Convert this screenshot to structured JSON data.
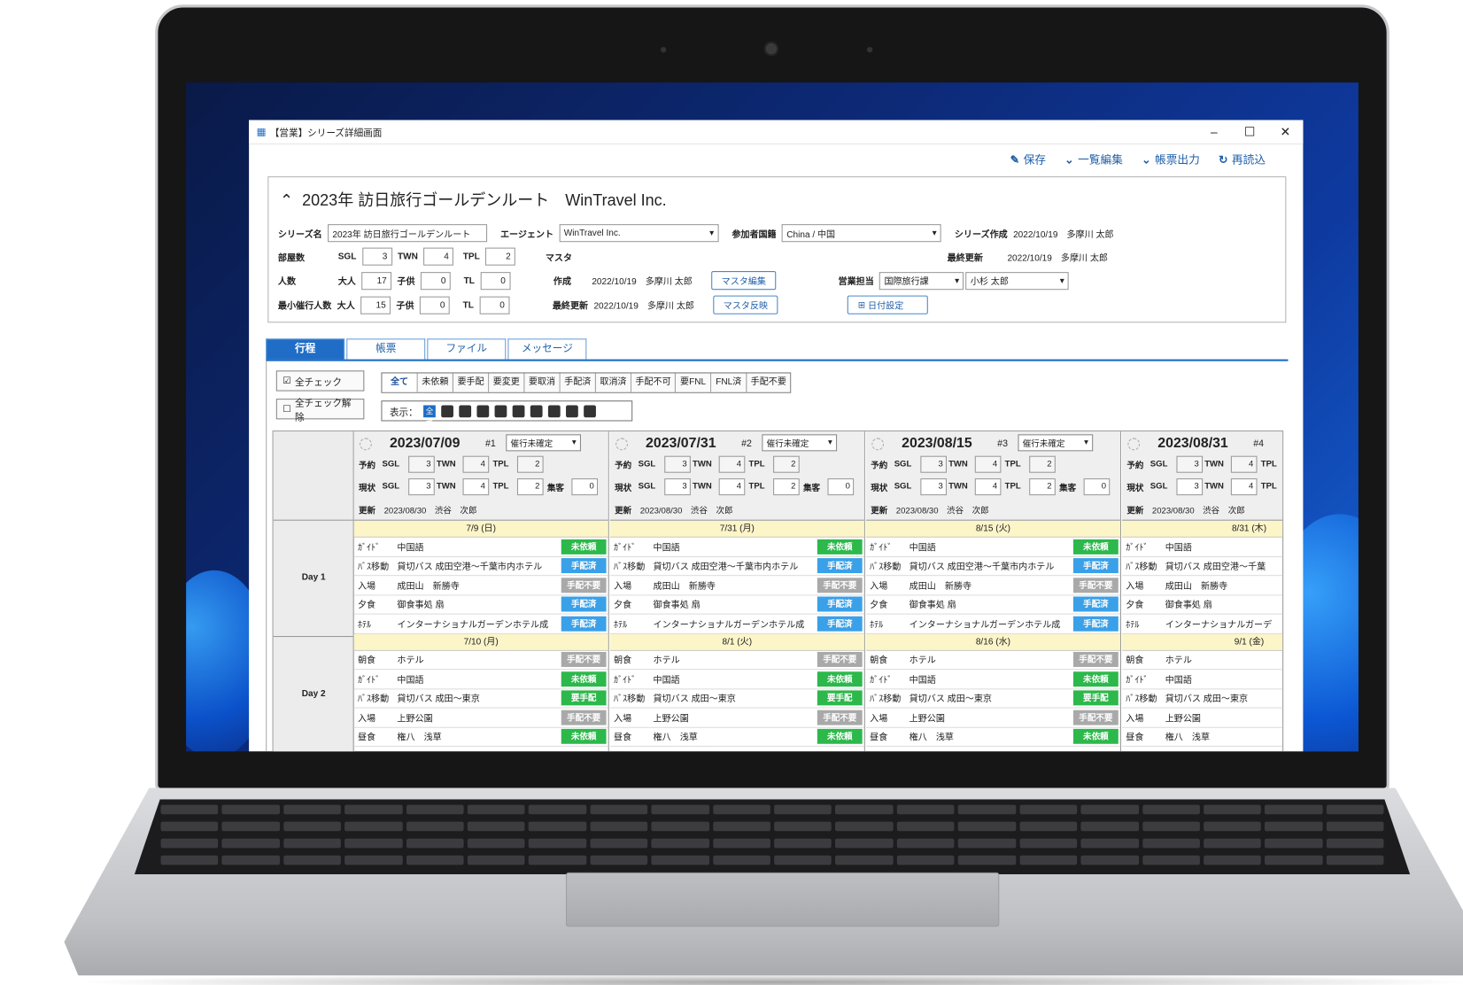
{
  "window": {
    "title": "【営業】シリーズ詳細画面",
    "controls": [
      "–",
      "☐",
      "✕"
    ]
  },
  "toolbar": {
    "save": "保存",
    "bulk_edit": "一覧編集",
    "report": "帳票出力",
    "reload": "再読込"
  },
  "header": {
    "title": "2023年 訪日旅行ゴールデンルート　WinTravel Inc."
  },
  "form": {
    "series_name_label": "シリーズ名",
    "series_name": "2023年 訪日旅行ゴールデンルート",
    "agent_label": "エージェント",
    "agent": "WinTravel Inc.",
    "nationality_label": "参加者国籍",
    "nationality": "China / 中国",
    "series_created_label": "シリーズ作成",
    "series_created": "2022/10/19　多摩川 太郎",
    "rooms_label": "部屋数",
    "sgl_label": "SGL",
    "sgl": "3",
    "twn_label": "TWN",
    "twn": "4",
    "tpl_label": "TPL",
    "tpl": "2",
    "master_label": "マスタ",
    "last_update_label": "最終更新",
    "last_update": "2022/10/19　多摩川 太郎",
    "people_label": "人数",
    "adult_label": "大人",
    "adult": "17",
    "child_label": "子供",
    "child": "0",
    "tl_label": "TL",
    "tl": "0",
    "created_label": "作成",
    "created": "2022/10/19　多摩川 太郎",
    "master_edit": "マスタ編集",
    "sales_label": "営業担当",
    "sales_dept": "国際旅行課",
    "sales_person": "小杉 太郎",
    "min_people_label": "最小催行人数",
    "min_adult": "15",
    "min_child": "0",
    "min_tl": "0",
    "last_update2_label": "最終更新",
    "last_update2": "2022/10/19　多摩川 太郎",
    "master_apply": "マスタ反映",
    "date_setting": "日付設定"
  },
  "tabs": [
    "行程",
    "帳票",
    "ファイル",
    "メッセージ"
  ],
  "filters": {
    "check_all": "全チェック",
    "uncheck_all": "全チェック解除",
    "status": [
      "全て",
      "未依頼",
      "要手配",
      "要変更",
      "要取消",
      "手配済",
      "取消済",
      "手配不可",
      "要FNL",
      "FNL済",
      "手配不要"
    ],
    "display_label": "表示：",
    "display_all": "全て"
  },
  "labels": {
    "yoyaku": "予約",
    "genjo": "現状",
    "shukyaku": "集客",
    "koushin": "更新",
    "sgl": "SGL",
    "twn": "TWN",
    "tpl": "TPL",
    "tw": "TI"
  },
  "days": [
    "Day 1",
    "Day 2"
  ],
  "columns": [
    {
      "date": "2023/07/09",
      "no": "#1",
      "status": "催行未確定",
      "r": [
        "3",
        "4",
        "2"
      ],
      "c": [
        "3",
        "4",
        "2",
        "0"
      ],
      "upd": "2023/08/30　渋谷　次郎",
      "d1": "7/9 (日)",
      "d2": "7/10 (月)",
      "day1": [
        [
          "ｶﾞｲﾄﾞ",
          "中国語",
          "未依頼",
          "g"
        ],
        [
          "ﾊﾞｽ移動",
          "貸切バス 成田空港～千葉市内ホテル",
          "手配済",
          "b"
        ],
        [
          "入場",
          "成田山　新勝寺",
          "手配不要",
          "x"
        ],
        [
          "夕食",
          "御食事処 扇",
          "手配済",
          "b"
        ],
        [
          "ﾎﾃﾙ",
          "インターナショナルガーデンホテル成",
          "手配済",
          "b"
        ]
      ],
      "day2": [
        [
          "朝食",
          "ホテル",
          "手配不要",
          "x"
        ],
        [
          "ｶﾞｲﾄﾞ",
          "中国語",
          "未依頼",
          "g"
        ],
        [
          "ﾊﾞｽ移動",
          "貸切バス 成田～東京",
          "要手配",
          "g"
        ],
        [
          "入場",
          "上野公園",
          "手配不要",
          "x"
        ],
        [
          "昼食",
          "権八　浅草",
          "未依頼",
          "g"
        ]
      ]
    },
    {
      "date": "2023/07/31",
      "no": "#2",
      "status": "催行未確定",
      "r": [
        "3",
        "4",
        "2"
      ],
      "c": [
        "3",
        "4",
        "2",
        "0"
      ],
      "upd": "2023/08/30　渋谷　次郎",
      "d1": "7/31 (月)",
      "d2": "8/1 (火)",
      "day1": [
        [
          "ｶﾞｲﾄﾞ",
          "中国語",
          "未依頼",
          "g"
        ],
        [
          "ﾊﾞｽ移動",
          "貸切バス 成田空港～千葉市内ホテル",
          "手配済",
          "b"
        ],
        [
          "入場",
          "成田山　新勝寺",
          "手配不要",
          "x"
        ],
        [
          "夕食",
          "御食事処 扇",
          "手配済",
          "b"
        ],
        [
          "ﾎﾃﾙ",
          "インターナショナルガーデンホテル成",
          "手配済",
          "b"
        ]
      ],
      "day2": [
        [
          "朝食",
          "ホテル",
          "手配不要",
          "x"
        ],
        [
          "ｶﾞｲﾄﾞ",
          "中国語",
          "未依頼",
          "g"
        ],
        [
          "ﾊﾞｽ移動",
          "貸切バス 成田～東京",
          "要手配",
          "g"
        ],
        [
          "入場",
          "上野公園",
          "手配不要",
          "x"
        ],
        [
          "昼食",
          "権八　浅草",
          "未依頼",
          "g"
        ]
      ]
    },
    {
      "date": "2023/08/15",
      "no": "#3",
      "status": "催行未確定",
      "r": [
        "3",
        "4",
        "2"
      ],
      "c": [
        "3",
        "4",
        "2",
        "0"
      ],
      "upd": "2023/08/30　渋谷　次郎",
      "d1": "8/15 (火)",
      "d2": "8/16 (水)",
      "day1": [
        [
          "ｶﾞｲﾄﾞ",
          "中国語",
          "未依頼",
          "g"
        ],
        [
          "ﾊﾞｽ移動",
          "貸切バス 成田空港～千葉市内ホテル",
          "手配済",
          "b"
        ],
        [
          "入場",
          "成田山　新勝寺",
          "手配不要",
          "x"
        ],
        [
          "夕食",
          "御食事処 扇",
          "手配済",
          "b"
        ],
        [
          "ﾎﾃﾙ",
          "インターナショナルガーデンホテル成",
          "手配済",
          "b"
        ]
      ],
      "day2": [
        [
          "朝食",
          "ホテル",
          "手配不要",
          "x"
        ],
        [
          "ｶﾞｲﾄﾞ",
          "中国語",
          "未依頼",
          "g"
        ],
        [
          "ﾊﾞｽ移動",
          "貸切バス 成田～東京",
          "要手配",
          "g"
        ],
        [
          "入場",
          "上野公園",
          "手配不要",
          "x"
        ],
        [
          "昼食",
          "権八　浅草",
          "未依頼",
          "g"
        ]
      ]
    },
    {
      "date": "2023/08/31",
      "no": "#4",
      "status": "",
      "r": [
        "3",
        "4",
        ""
      ],
      "c": [
        "3",
        "4",
        "",
        ""
      ],
      "upd": "2023/08/30　渋谷　次郎",
      "d1": "8/31 (木)",
      "d2": "9/1 (金)",
      "day1": [
        [
          "ｶﾞｲﾄﾞ",
          "中国語",
          "",
          ""
        ],
        [
          "ﾊﾞｽ移動",
          "貸切バス 成田空港～千葉",
          "",
          ""
        ],
        [
          "入場",
          "成田山　新勝寺",
          "",
          ""
        ],
        [
          "夕食",
          "御食事処 扇",
          "",
          ""
        ],
        [
          "ﾎﾃﾙ",
          "インターナショナルガーデ",
          "",
          ""
        ]
      ],
      "day2": [
        [
          "朝食",
          "ホテル",
          "",
          ""
        ],
        [
          "ｶﾞｲﾄﾞ",
          "中国語",
          "",
          ""
        ],
        [
          "ﾊﾞｽ移動",
          "貸切バス 成田～東京",
          "",
          ""
        ],
        [
          "入場",
          "上野公園",
          "",
          ""
        ],
        [
          "昼食",
          "権八　浅草",
          "",
          ""
        ]
      ]
    }
  ]
}
